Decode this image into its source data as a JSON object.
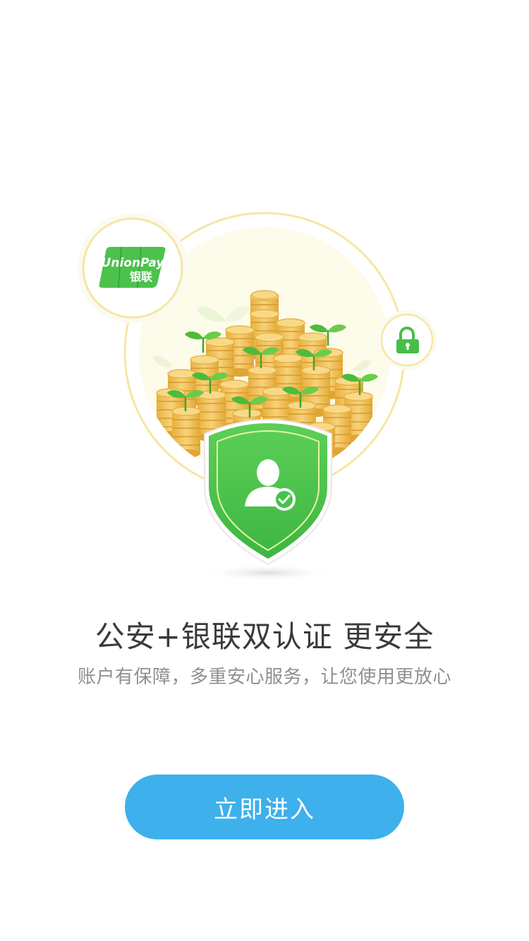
{
  "onboarding": {
    "badge_logo": {
      "brand_en": "UnionPay",
      "brand_cn": "银联"
    },
    "headline": "公安+银联双认证 更安全",
    "subline": "账户有保障，多重安心服务，让您使用更放心",
    "enter_button_label": "立即进入"
  },
  "colors": {
    "accent_blue": "#3eb0ec",
    "shield_green": "#45c24a",
    "coin_gold": "#f2c55a",
    "ring_yellow": "#f6e9a6"
  },
  "icons": {
    "unionpay": "unionpay-logo-icon",
    "lock": "lock-icon",
    "shield": "shield-icon",
    "user_verified": "user-check-icon"
  }
}
